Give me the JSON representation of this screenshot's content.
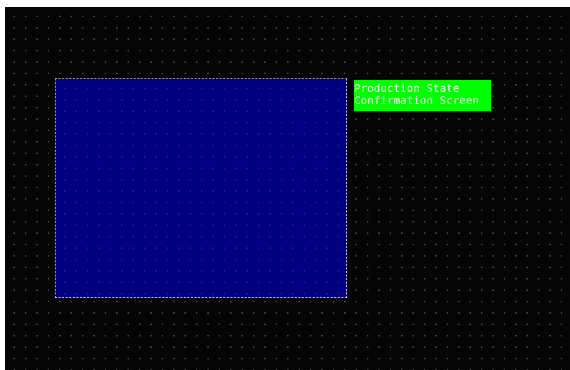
{
  "screen": {
    "background_color": "#050505",
    "grid_dot_color": "#6a6a6a",
    "grid_visible": true
  },
  "rectangle": {
    "fill_color": "#000080",
    "border_style": "dashed",
    "border_color": "#e8e8e8",
    "selected": true
  },
  "label": {
    "line1": "Production State",
    "line2": "Confirmation Screen",
    "background_color": "#00ff00",
    "text_color": "#ffffff"
  }
}
